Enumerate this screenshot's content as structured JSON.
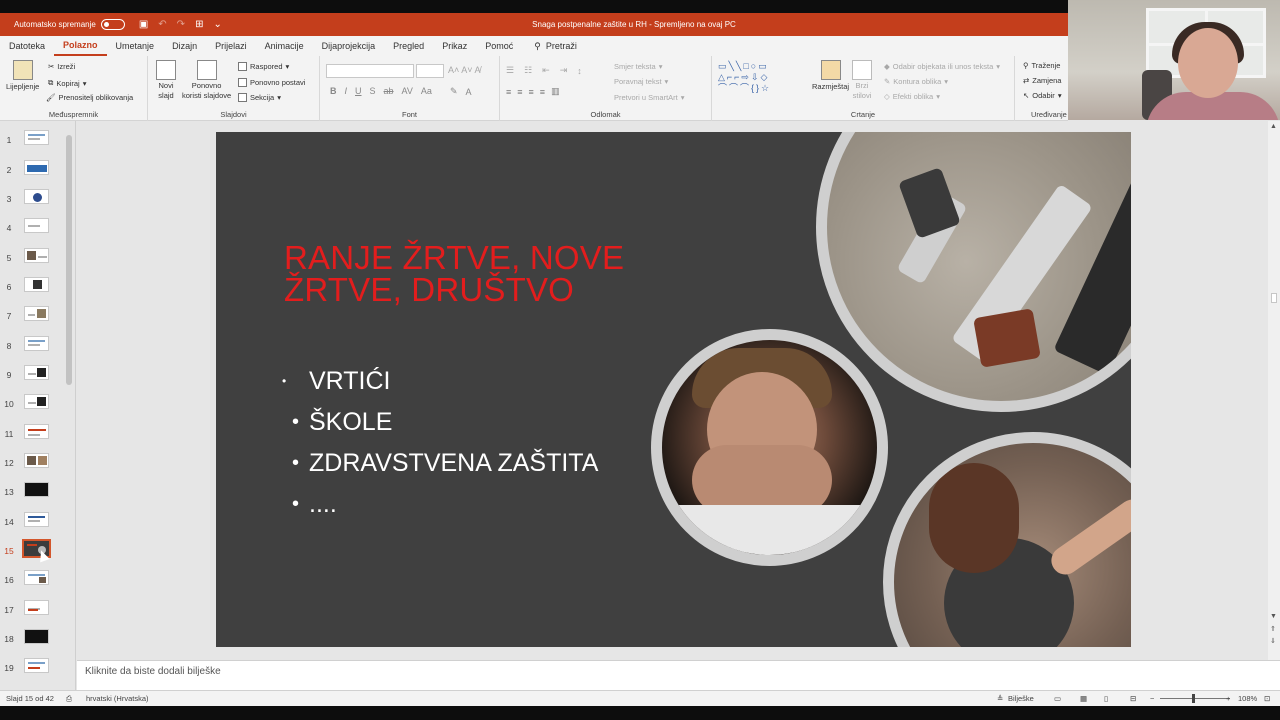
{
  "titlebar": {
    "autosave_label": "Automatsko spremanje",
    "document_title": "Snaga postpenalne zaštite u RH  -  Spremljeno na ovaj PC"
  },
  "menu": {
    "tabs": [
      "Datoteka",
      "Polazno",
      "Umetanje",
      "Dizajn",
      "Prijelazi",
      "Animacije",
      "Dijaprojekcija",
      "Pregled",
      "Prikaz",
      "Pomoć"
    ],
    "active_tab": "Polazno",
    "search_label": "Pretraži"
  },
  "ribbon": {
    "clipboard": {
      "paste": "Lijepljenje",
      "cut": "Izreži",
      "copy": "Kopiraj",
      "format_painter": "Prenositelj oblikovanja",
      "label": "Međuspremnik"
    },
    "slides": {
      "new_slide_1": "Novi",
      "new_slide_2": "slajd",
      "reuse_1": "Ponovno",
      "reuse_2": "koristi slajdove",
      "layout": "Raspored",
      "reset": "Ponovno postavi",
      "section": "Sekcija",
      "label": "Slajdovi"
    },
    "font": {
      "label": "Font"
    },
    "paragraph": {
      "text_direction": "Smjer teksta",
      "align_text": "Poravnaj tekst",
      "smartart": "Pretvori u SmartArt",
      "label": "Odlomak"
    },
    "drawing": {
      "arrange": "Razmještaj",
      "quick_styles_1": "Brzi",
      "quick_styles_2": "stilovi",
      "selection": "Odabir objekata ili unos teksta",
      "shape_outline": "Kontura oblika",
      "shape_effects": "Efekti oblika",
      "label": "Crtanje"
    },
    "editing": {
      "find": "Traženje",
      "replace": "Zamjena",
      "select": "Odabir",
      "label": "Uređivanje"
    }
  },
  "thumbnails": {
    "numbers": [
      "1",
      "2",
      "3",
      "4",
      "5",
      "6",
      "7",
      "8",
      "9",
      "10",
      "11",
      "12",
      "13",
      "14",
      "15",
      "16",
      "17",
      "18",
      "19"
    ],
    "selected": "15"
  },
  "slide": {
    "title": "RANJE ŽRTVE, NOVE ŽRTVE, DRUŠTVO",
    "bullets": [
      {
        "marker": "•",
        "text": "VRTIĆI"
      },
      {
        "marker": "•",
        "text": "ŠKOLE"
      },
      {
        "marker": "•",
        "text": "ZDRAVSTVENA ZAŠTITA"
      },
      {
        "marker": "•",
        "text": "...."
      }
    ]
  },
  "notes": {
    "placeholder": "Kliknite da biste dodali bilješke"
  },
  "status": {
    "slide_counter": "Slajd 15 od 42",
    "language": "hrvatski (Hrvatska)",
    "notes_button": "Bilješke",
    "zoom": "108%"
  },
  "colors": {
    "accent": "#c43e1c",
    "slide_bg": "#404040",
    "title_red": "#e31d1d"
  }
}
